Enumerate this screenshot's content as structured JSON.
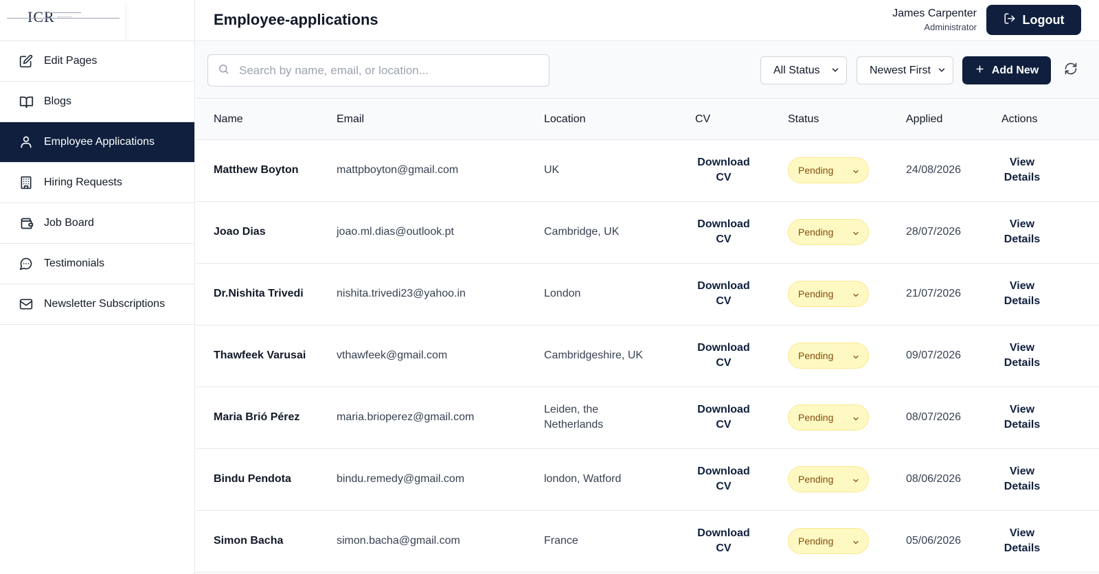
{
  "logo": {
    "text": "ICR"
  },
  "sidebar": {
    "items": [
      {
        "label": "Edit Pages",
        "icon": "edit-icon",
        "active": false
      },
      {
        "label": "Blogs",
        "icon": "book-icon",
        "active": false
      },
      {
        "label": "Employee Applications",
        "icon": "user-icon",
        "active": true
      },
      {
        "label": "Hiring Requests",
        "icon": "building-icon",
        "active": false
      },
      {
        "label": "Job Board",
        "icon": "wallet-icon",
        "active": false
      },
      {
        "label": "Testimonials",
        "icon": "chat-icon",
        "active": false
      },
      {
        "label": "Newsletter Subscriptions",
        "icon": "mail-icon",
        "active": false
      }
    ]
  },
  "header": {
    "title": "Employee-applications",
    "user_name": "James Carpenter",
    "user_role": "Administrator",
    "logout_label": "Logout"
  },
  "toolbar": {
    "search_placeholder": "Search by name, email, or location...",
    "status_filter": "All Status",
    "sort_order": "Newest First",
    "add_label": "Add New"
  },
  "table": {
    "columns": [
      "Name",
      "Email",
      "Location",
      "CV",
      "Status",
      "Applied",
      "Actions"
    ],
    "rows": [
      {
        "name": "Matthew Boyton",
        "email": "mattpboyton@gmail.com",
        "location": "UK",
        "cv_1": "Download",
        "cv_2": "CV",
        "status": "Pending",
        "applied": "24/08/2026",
        "action_1": "View",
        "action_2": "Details"
      },
      {
        "name": "Joao Dias",
        "email": "joao.ml.dias@outlook.pt",
        "location": "Cambridge, UK",
        "cv_1": "Download",
        "cv_2": "CV",
        "status": "Pending",
        "applied": "28/07/2026",
        "action_1": "View",
        "action_2": "Details"
      },
      {
        "name": "Dr.Nishita Trivedi",
        "email": "nishita.trivedi23@yahoo.in",
        "location": "London",
        "cv_1": "Download",
        "cv_2": "CV",
        "status": "Pending",
        "applied": "21/07/2026",
        "action_1": "View",
        "action_2": "Details"
      },
      {
        "name": "Thawfeek Varusai",
        "email": "vthawfeek@gmail.com",
        "location": "Cambridgeshire, UK",
        "cv_1": "Download",
        "cv_2": "CV",
        "status": "Pending",
        "applied": "09/07/2026",
        "action_1": "View",
        "action_2": "Details"
      },
      {
        "name": "Maria Brió Pérez",
        "email": "maria.brioperez@gmail.com",
        "location": "Leiden, the Netherlands",
        "cv_1": "Download",
        "cv_2": "CV",
        "status": "Pending",
        "applied": "08/07/2026",
        "action_1": "View",
        "action_2": "Details"
      },
      {
        "name": "Bindu Pendota",
        "email": "bindu.remedy@gmail.com",
        "location": "london, Watford",
        "cv_1": "Download",
        "cv_2": "CV",
        "status": "Pending",
        "applied": "08/06/2026",
        "action_1": "View",
        "action_2": "Details"
      },
      {
        "name": "Simon Bacha",
        "email": "simon.bacha@gmail.com",
        "location": "France",
        "cv_1": "Download",
        "cv_2": "CV",
        "status": "Pending",
        "applied": "05/06/2026",
        "action_1": "View",
        "action_2": "Details"
      }
    ]
  },
  "colors": {
    "primary": "#0f1f3d",
    "pending_bg": "#fef9c3",
    "pending_text": "#854d0e"
  }
}
